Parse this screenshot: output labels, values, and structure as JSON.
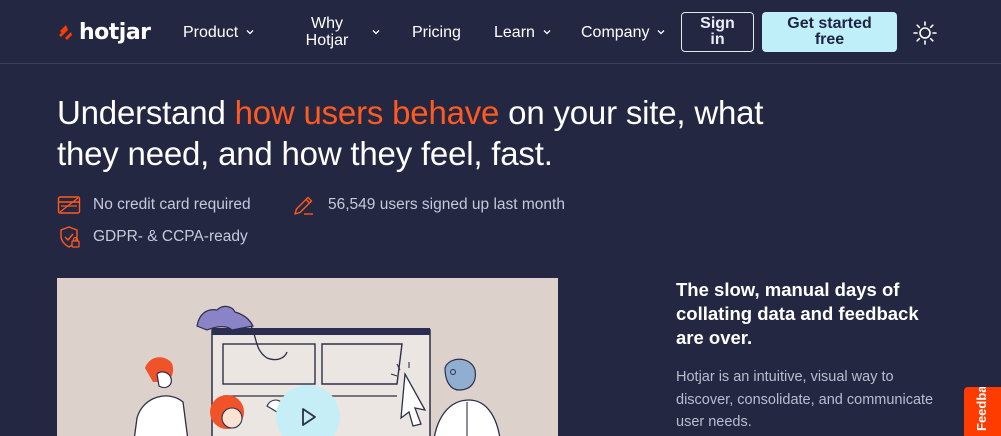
{
  "nav": {
    "logo_text": "hotjar",
    "items": [
      {
        "label": "Product",
        "has_dropdown": true
      },
      {
        "label": "Why Hotjar",
        "has_dropdown": true
      },
      {
        "label": "Pricing",
        "has_dropdown": false
      },
      {
        "label": "Learn",
        "has_dropdown": true
      },
      {
        "label": "Company",
        "has_dropdown": true
      }
    ],
    "sign_in_label": "Sign in",
    "get_started_label": "Get started free",
    "theme_toggle_icon": "sun-icon"
  },
  "hero": {
    "title_part1": "Understand ",
    "title_accent": "how users behave",
    "title_part2": " on your site, what they need, and how they feel, fast.",
    "features": [
      {
        "icon": "credit-card-icon",
        "text": "No credit card required"
      },
      {
        "icon": "pencil-icon",
        "text": "56,549 users signed up last month"
      },
      {
        "icon": "shield-lock-icon",
        "text": "GDPR- & CCPA-ready"
      }
    ]
  },
  "video": {
    "play_icon": "play-icon"
  },
  "side": {
    "heading": "The slow, manual days of collating data and feedback are over.",
    "body": "Hotjar is an intuitive, visual way to discover, consolidate, and communicate user needs."
  },
  "feedback_tab": {
    "label": "Feedback"
  },
  "colors": {
    "background": "#242741",
    "accent": "#ff5a1f",
    "cta": "#bfeff9",
    "feedback": "#ff3c00"
  }
}
